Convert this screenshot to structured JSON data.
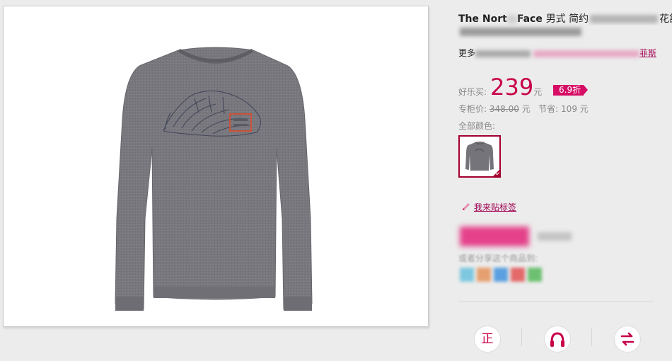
{
  "product": {
    "title": "The Nort",
    "title_mid": "Face",
    "title_cn": "男式 简约",
    "title_tail": "花舒适"
  },
  "more": {
    "prefix": "更多",
    "link_label": "菲斯"
  },
  "price": {
    "label": "好乐买:",
    "value": "239",
    "unit": "元",
    "discount": "6.9折"
  },
  "original": {
    "label": "专柜价:",
    "value": "348.00",
    "unit": "元",
    "save_label": "节省:",
    "save_value": "109",
    "save_unit": "元"
  },
  "colors": {
    "label": "全部颜色:"
  },
  "tag": {
    "label": "我来贴标签"
  },
  "share": {
    "label": "或者分享这个商品到:"
  },
  "actions": {
    "btn1_glyph": "正"
  },
  "accent": "#c8004a"
}
